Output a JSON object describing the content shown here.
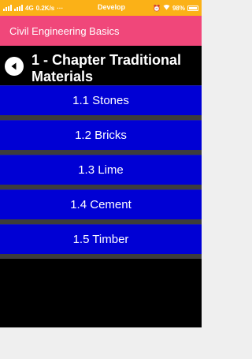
{
  "status_bar": {
    "network": "4G",
    "speed": "0.2K/s",
    "dots": "···",
    "carrier_label": "Develop",
    "battery_percent": "98%"
  },
  "app_bar": {
    "title": "Civil Engineering Basics"
  },
  "chapter": {
    "title_line1": "1 - Chapter Traditional",
    "title_line2": "Materials"
  },
  "lessons": [
    {
      "label": "1.1 Stones"
    },
    {
      "label": "1.2 Bricks"
    },
    {
      "label": "1.3 Lime"
    },
    {
      "label": "1.4 Cement"
    },
    {
      "label": "1.5 Timber"
    }
  ],
  "colors": {
    "status_bar": "#fbb117",
    "app_bar": "#f0477a",
    "lesson_item": "#0000d4",
    "background": "#000000"
  }
}
